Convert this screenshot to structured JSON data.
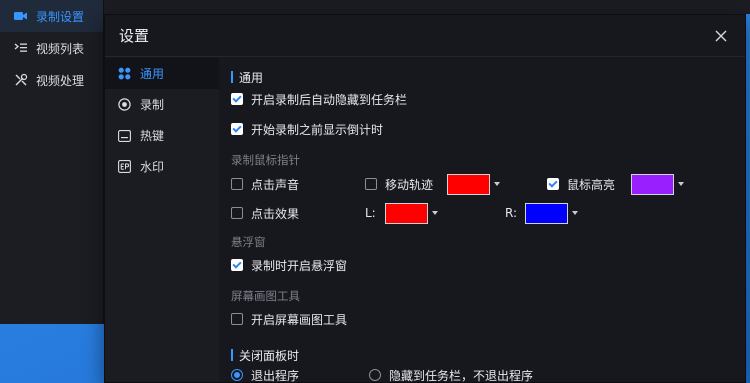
{
  "app": {
    "nav": [
      {
        "label": "录制设置",
        "icon": "camera-icon"
      },
      {
        "label": "视频列表",
        "icon": "list-icon"
      },
      {
        "label": "视频处理",
        "icon": "tools-icon"
      }
    ]
  },
  "dialog": {
    "title": "设置",
    "close_icon": "close-icon",
    "sidebar": [
      {
        "label": "通用",
        "icon": "grid-icon"
      },
      {
        "label": "录制",
        "icon": "record-icon"
      },
      {
        "label": "热键",
        "icon": "keyboard-icon"
      },
      {
        "label": "水印",
        "icon": "watermark-icon"
      }
    ],
    "general": {
      "section_title": "通用",
      "auto_hide": {
        "label": "开启录制后自动隐藏到任务栏",
        "checked": true
      },
      "countdown": {
        "label": "开始录制之前显示倒计时",
        "checked": true
      }
    },
    "mouse": {
      "group_label": "录制鼠标指针",
      "click_sound": {
        "label": "点击声音",
        "checked": false
      },
      "move_track": {
        "label": "移动轨迹",
        "checked": false,
        "color": "#ff0000"
      },
      "highlight": {
        "label": "鼠标高亮",
        "checked": true,
        "color": "#9a1fff"
      },
      "click_effect": {
        "label": "点击效果",
        "checked": false
      },
      "left_label": "L:",
      "left_color": "#ff0000",
      "right_label": "R:",
      "right_color": "#0000ff"
    },
    "floating": {
      "group_label": "悬浮窗",
      "open_float": {
        "label": "录制时开启悬浮窗",
        "checked": true
      }
    },
    "drawing": {
      "group_label": "屏幕画图工具",
      "open_tool": {
        "label": "开启屏幕画图工具",
        "checked": false
      }
    },
    "close_panel": {
      "section_title": "关闭面板时",
      "options": [
        {
          "label": "退出程序",
          "selected": true
        },
        {
          "label": "隐藏到任务栏，不退出程序",
          "selected": false
        }
      ]
    }
  },
  "colors": {
    "accent": "#3a95ff",
    "dialog_bg": "#17181d",
    "sidebar_bg": "#1a1c21",
    "desktop": "#2f86e8"
  }
}
